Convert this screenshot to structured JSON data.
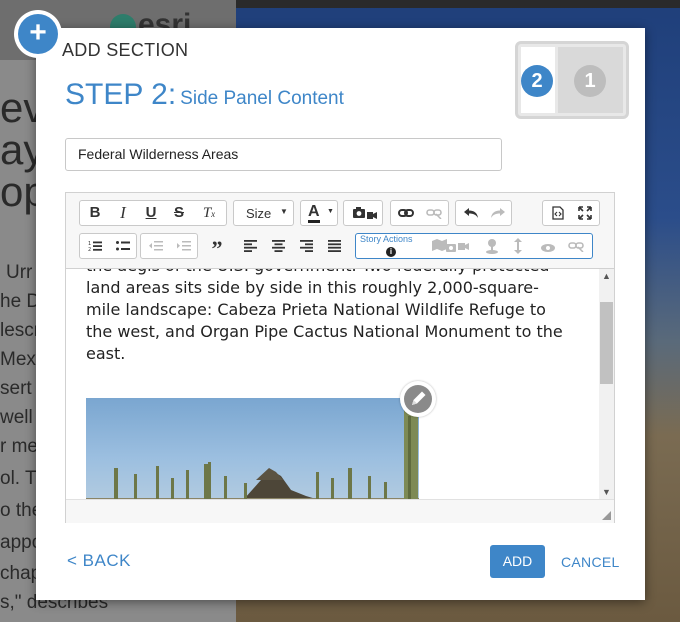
{
  "background": {
    "logo_text": "esri",
    "big_lines": [
      "ev",
      "ay",
      "opt"
    ],
    "small_lines": [
      "Urr",
      "he D",
      "lescr",
      "Mex",
      "sert",
      "well",
      "r me",
      "ol. T",
      "o the",
      "appo",
      "chap",
      "s,\" describes"
    ]
  },
  "dialog": {
    "header": "ADD SECTION",
    "step_label": "STEP 2:",
    "step_subtitle": "Side Panel Content",
    "layout_thumb": {
      "side_number": "2",
      "main_number": "1"
    },
    "title_input_value": "Federal Wilderness Areas",
    "toolbar": {
      "size_label": "Size",
      "story_actions_label": "Story Actions",
      "info_glyph": "i"
    },
    "content_text": "the aegis of the U.S. government. Two federally protected land areas sits side by side in this roughly 2,000-square-mile landscape: Cabeza Prieta National Wildlife Refuge to the west, and Organ Pipe Cactus National Monument to the east.",
    "back_label": "< BACK",
    "add_label": "ADD",
    "cancel_label": "CANCEL"
  },
  "colors": {
    "accent": "#3e86c8"
  }
}
